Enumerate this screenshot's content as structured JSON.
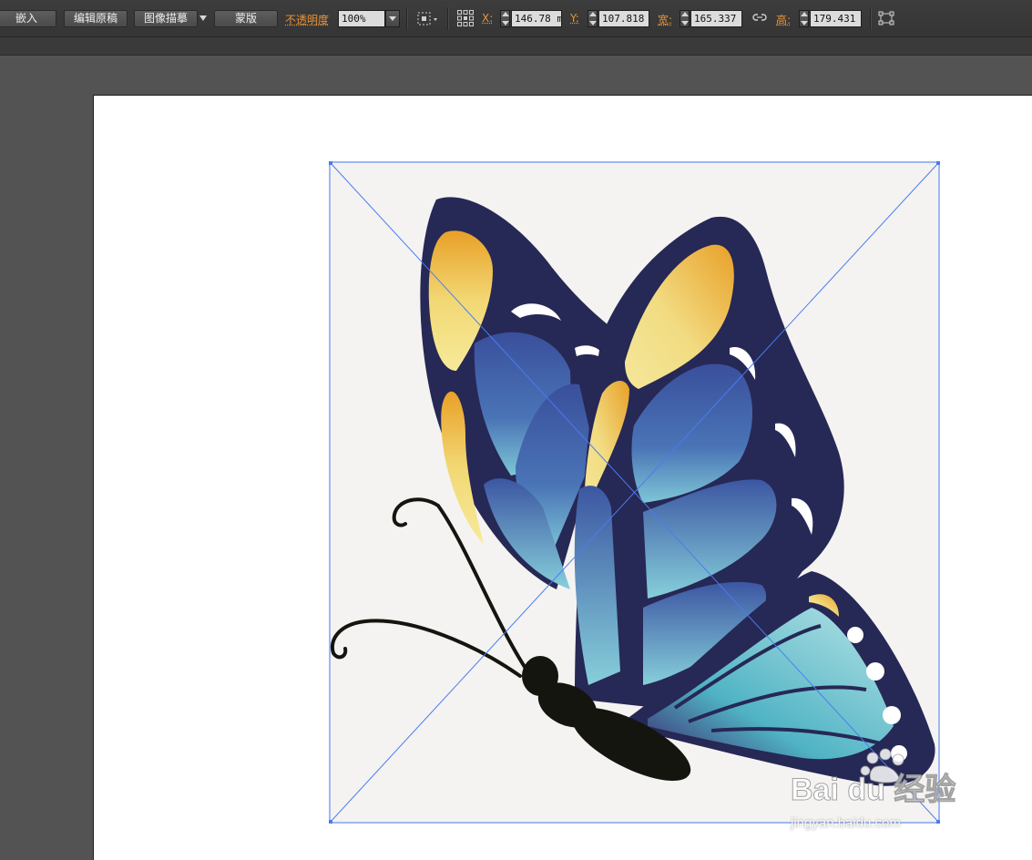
{
  "control_bar": {
    "embed_label": "嵌入",
    "edit_original_label": "编辑原稿",
    "image_trace_label": "图像描摹",
    "mask_label": "蒙版",
    "opacity_label": "不透明度",
    "opacity_value": "100%",
    "x_label": "X:",
    "x_value": "146.78 mm",
    "y_label": "Y:",
    "y_value": "107.818 mm",
    "width_label": "宽:",
    "width_value": "165.337 mm",
    "height_label": "高:",
    "height_value": "179.431 mm"
  },
  "watermark": {
    "brand_text": "Bai du 经验",
    "url_text": "jingyan.baidu.com"
  },
  "colors": {
    "toolbar_bg": "#3a3a3a",
    "pasteboard": "#535353",
    "artboard": "#ffffff",
    "selection": "#4a7cf0",
    "label_orange": "#e8923a",
    "wing_dark": "#262855",
    "wing_blue": "#3e5aa6",
    "wing_yellow": "#f0d36a",
    "wing_teal": "#5fb9c7",
    "body": "#15150f"
  }
}
